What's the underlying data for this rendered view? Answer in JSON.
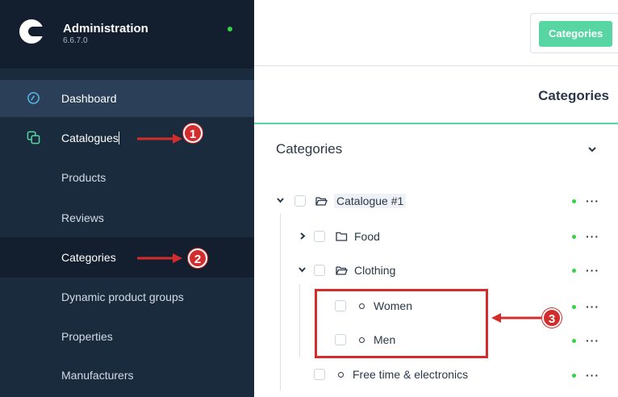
{
  "app": {
    "title": "Administration",
    "version": "6.6.7.0"
  },
  "sidebar": {
    "items": [
      {
        "label": "Dashboard",
        "icon": "dashboard-icon"
      },
      {
        "label": "Catalogues",
        "icon": "catalogues-icon"
      }
    ],
    "subitems": [
      {
        "label": "Products"
      },
      {
        "label": "Reviews"
      },
      {
        "label": "Categories"
      },
      {
        "label": "Dynamic product groups"
      },
      {
        "label": "Properties"
      },
      {
        "label": "Manufacturers"
      }
    ]
  },
  "topbar": {
    "tab_label": "Categories"
  },
  "page": {
    "title": "Categories"
  },
  "card": {
    "title": "Categories"
  },
  "tree": [
    {
      "label": "Catalogue #1"
    },
    {
      "label": "Food"
    },
    {
      "label": "Clothing"
    },
    {
      "label": "Women"
    },
    {
      "label": "Men"
    },
    {
      "label": "Free time & electronics"
    }
  ],
  "annotations": {
    "m1": "1",
    "m2": "2",
    "m3": "3"
  },
  "colors": {
    "accent": "#57d6a3",
    "annotation": "#d32c2c",
    "status": "#37d046",
    "sidebar": "#1b2b3e"
  }
}
